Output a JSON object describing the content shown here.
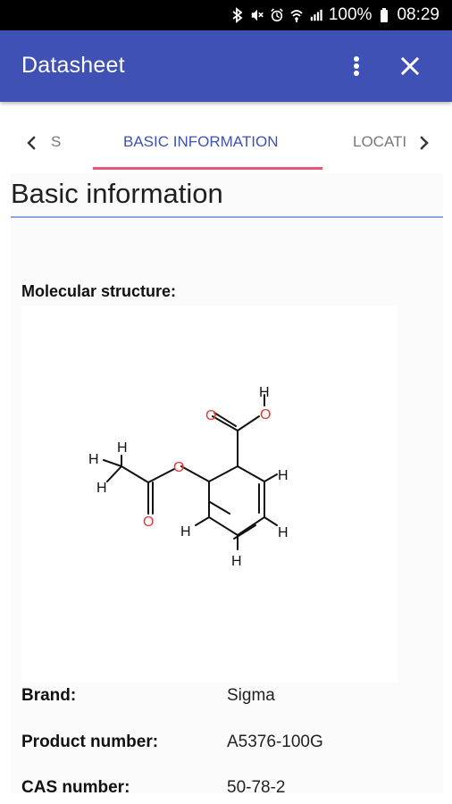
{
  "status_bar": {
    "battery_text": "100%",
    "time": "08:29",
    "icons": [
      "bluetooth-icon",
      "mute-icon",
      "alarm-icon",
      "wifi-icon",
      "signal-icon",
      "battery-icon"
    ]
  },
  "app_bar": {
    "title": "Datasheet",
    "menu_icon": "more-vert-icon",
    "close_icon": "close-icon"
  },
  "tabs": {
    "previous_partial": "S",
    "active": "BASIC INFORMATION",
    "next_partial": "LOCATI",
    "accent_color": "#e85776",
    "active_color": "#3f51b5"
  },
  "section": {
    "heading": "Basic information",
    "structure_label": "Molecular structure:"
  },
  "molecule": {
    "atom_labels": {
      "oxygen_1": "O",
      "oxygen_2": "O",
      "oxygen_3": "O",
      "oxygen_4": "O",
      "hydrogen_1": "H",
      "hydrogen_2": "H",
      "hydrogen_3": "H",
      "hydrogen_4": "H",
      "hydrogen_5": "H",
      "hydrogen_6": "H",
      "hydrogen_7": "H",
      "hydrogen_8": "H"
    }
  },
  "details": [
    {
      "label": "Brand:",
      "value": "Sigma"
    },
    {
      "label": "Product number:",
      "value": "A5376-100G"
    },
    {
      "label": "CAS number:",
      "value": "50-78-2"
    }
  ],
  "colors": {
    "status_bar": "#000000",
    "app_bar": "#3f51b5",
    "section_rule": "#8ea6db",
    "oxygen": "#e53935"
  }
}
